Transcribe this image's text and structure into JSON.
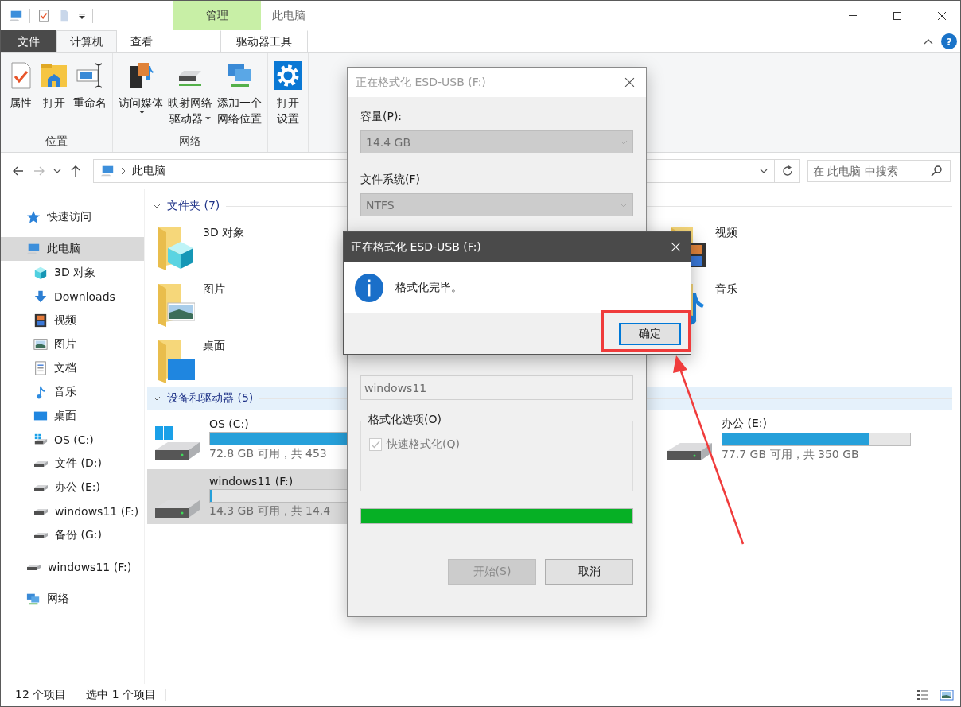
{
  "window": {
    "title": "此电脑",
    "help": "?"
  },
  "contextual_tab_group": {
    "label": "管理"
  },
  "tabs": [
    {
      "label": "文件",
      "kind": "file",
      "selected": false
    },
    {
      "label": "计算机",
      "kind": "tab",
      "selected": true
    },
    {
      "label": "查看",
      "kind": "tab",
      "selected": false
    },
    {
      "label": "驱动器工具",
      "kind": "context",
      "selected": false
    }
  ],
  "ribbon_groups": [
    {
      "label": "位置",
      "commands": [
        {
          "lines": [
            "属性"
          ],
          "dropdown": false
        },
        {
          "lines": [
            "打开"
          ],
          "dropdown": false
        },
        {
          "lines": [
            "重命名"
          ],
          "dropdown": false
        }
      ]
    },
    {
      "label": "网络",
      "commands": [
        {
          "lines": [
            "访问媒体"
          ],
          "dropdown": true
        },
        {
          "lines": [
            "映射网络",
            "驱动器"
          ],
          "dropdown": true
        },
        {
          "lines": [
            "添加一个",
            "网络位置"
          ],
          "dropdown": false
        }
      ]
    },
    {
      "commands": [
        {
          "lines": [
            "打开",
            "设置"
          ],
          "dropdown": false
        }
      ]
    }
  ],
  "address_bar": {
    "path": "此电脑"
  },
  "search": {
    "placeholder": "在 此电脑 中搜索"
  },
  "nav_pane": [
    {
      "label": "快速访问",
      "selected": false
    },
    {
      "label": "此电脑",
      "selected": true,
      "children": [
        {
          "label": "3D 对象",
          "selected": false
        },
        {
          "label": "Downloads",
          "selected": false
        },
        {
          "label": "视频",
          "selected": false
        },
        {
          "label": "图片",
          "selected": false
        },
        {
          "label": "文档",
          "selected": false
        },
        {
          "label": "音乐",
          "selected": false
        },
        {
          "label": "桌面",
          "selected": false
        },
        {
          "label": "OS (C:)",
          "selected": false
        },
        {
          "label": "文件 (D:)",
          "selected": false
        },
        {
          "label": "办公 (E:)",
          "selected": false
        },
        {
          "label": "windows11 (F:)",
          "selected": false
        },
        {
          "label": "备份 (G:)",
          "selected": false
        }
      ]
    },
    {
      "label": "windows11 (F:)",
      "selected": false
    },
    {
      "label": "网络",
      "selected": false
    }
  ],
  "sections": [
    {
      "title": "文件夹 (7)",
      "kind": "folders",
      "expanded": true,
      "highlighted": false,
      "items": [
        {
          "label": "3D 对象",
          "selected": false
        },
        {
          "label": "视频",
          "selected": false
        },
        {
          "label": "图片",
          "selected": false
        },
        {
          "label": "音乐",
          "selected": false
        },
        {
          "label": "桌面",
          "selected": false
        }
      ]
    },
    {
      "title": "设备和驱动器 (5)",
      "kind": "drives",
      "expanded": true,
      "highlighted": true,
      "items": [
        {
          "label": "OS (C:)",
          "level": 0.84,
          "free": "72.8 GB 可用，共 453",
          "selected": false
        },
        {
          "label": "办公 (E:)",
          "level": 0.78,
          "free": "77.7 GB 可用，共 350 GB",
          "selected": false
        },
        {
          "label": "windows11 (F:)",
          "level": 0.01,
          "free": "14.3 GB 可用，共 14.4",
          "selected": true
        }
      ]
    }
  ],
  "status_bar": {
    "item_count": "12 个项目",
    "selection": "选中 1 个项目"
  },
  "format_dialog": {
    "title": "正在格式化 ESD-USB (F:)",
    "active": false,
    "fields": [
      {
        "label": "容量(P):",
        "value": "14.4 GB",
        "kind": "combo"
      },
      {
        "label": "文件系统(F)",
        "value": "NTFS",
        "kind": "combo"
      },
      {
        "value": "windows11",
        "kind": "text"
      }
    ],
    "options": {
      "title": "格式化选项(O)",
      "checkboxes": [
        {
          "label": "快速格式化(Q)",
          "checked": true,
          "disabled": true
        }
      ]
    },
    "progress": {
      "level": 1
    },
    "buttons": [
      {
        "label": "开始(S)",
        "disabled": true
      },
      {
        "label": "取消",
        "disabled": false
      }
    ]
  },
  "message_box": {
    "title": "正在格式化 ESD-USB (F:)",
    "message": "格式化完毕。",
    "buttons": [
      {
        "label": "确定",
        "default": true
      }
    ],
    "highlighted": true
  }
}
